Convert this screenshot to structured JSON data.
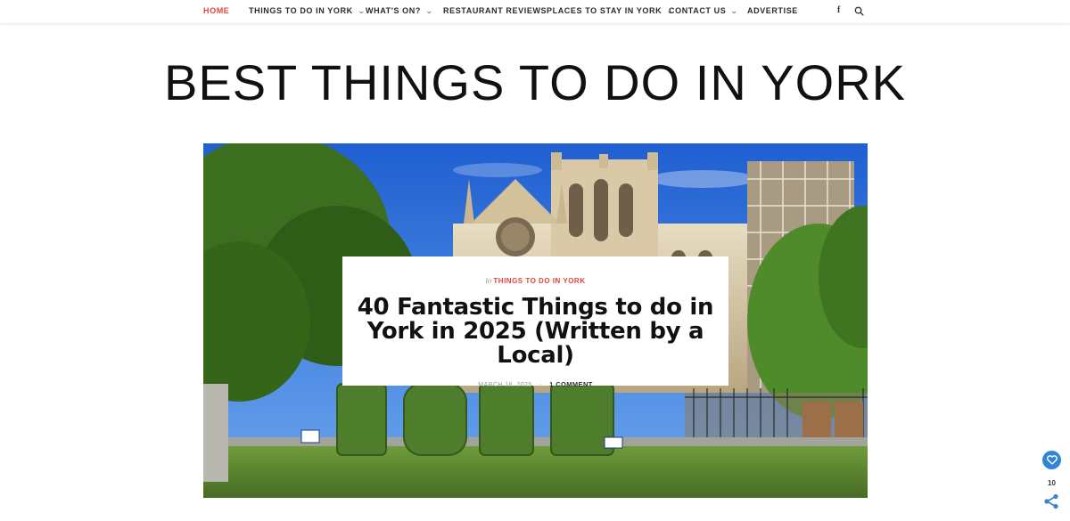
{
  "nav": {
    "items": [
      {
        "label": "Home",
        "active": true,
        "dropdown": false
      },
      {
        "label": "Things to do in York",
        "active": false,
        "dropdown": true
      },
      {
        "label": "What's On?",
        "active": false,
        "dropdown": true
      },
      {
        "label": "Restaurant Reviews",
        "active": false,
        "dropdown": false
      },
      {
        "label": "Places to stay in York",
        "active": false,
        "dropdown": true
      },
      {
        "label": "Contact Us",
        "active": false,
        "dropdown": true
      },
      {
        "label": "Advertise",
        "active": false,
        "dropdown": false
      }
    ],
    "social_icons": [
      "facebook-icon",
      "search-icon"
    ],
    "chevron": "⌄"
  },
  "site": {
    "title": "BEST THINGS TO DO IN YORK"
  },
  "post": {
    "category_prefix": "In",
    "category": "Things to do in York",
    "title": "40 Fantastic Things to do in York in 2025 (Written by a Local)",
    "date": "March 18, 2025",
    "separator": "-",
    "comments": "1 Comment"
  },
  "widgets": {
    "share_count": "10"
  },
  "colors": {
    "accent": "#e5443f",
    "text": "#111111",
    "widget_blue": "#2f86d7"
  }
}
